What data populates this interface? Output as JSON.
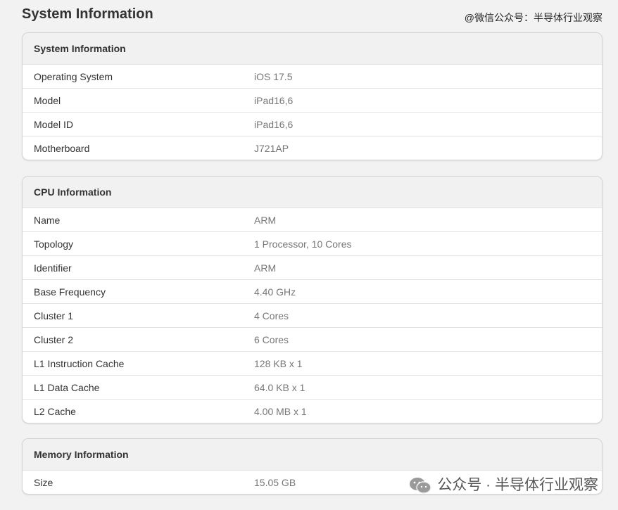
{
  "page_title": "System Information",
  "watermark_top": "@微信公众号：半导体行业观察",
  "watermark_bottom": "公众号 · 半导体行业观察",
  "sections": {
    "system": {
      "header": "System Information",
      "rows": [
        {
          "label": "Operating System",
          "value": "iOS 17.5"
        },
        {
          "label": "Model",
          "value": "iPad16,6"
        },
        {
          "label": "Model ID",
          "value": "iPad16,6"
        },
        {
          "label": "Motherboard",
          "value": "J721AP"
        }
      ]
    },
    "cpu": {
      "header": "CPU Information",
      "rows": [
        {
          "label": "Name",
          "value": "ARM"
        },
        {
          "label": "Topology",
          "value": "1 Processor, 10 Cores"
        },
        {
          "label": "Identifier",
          "value": "ARM"
        },
        {
          "label": "Base Frequency",
          "value": "4.40 GHz"
        },
        {
          "label": "Cluster 1",
          "value": "4 Cores"
        },
        {
          "label": "Cluster 2",
          "value": "6 Cores"
        },
        {
          "label": "L1 Instruction Cache",
          "value": "128 KB x 1"
        },
        {
          "label": "L1 Data Cache",
          "value": "64.0 KB x 1"
        },
        {
          "label": "L2 Cache",
          "value": "4.00 MB x 1"
        }
      ]
    },
    "memory": {
      "header": "Memory Information",
      "rows": [
        {
          "label": "Size",
          "value": "15.05 GB"
        }
      ]
    }
  }
}
